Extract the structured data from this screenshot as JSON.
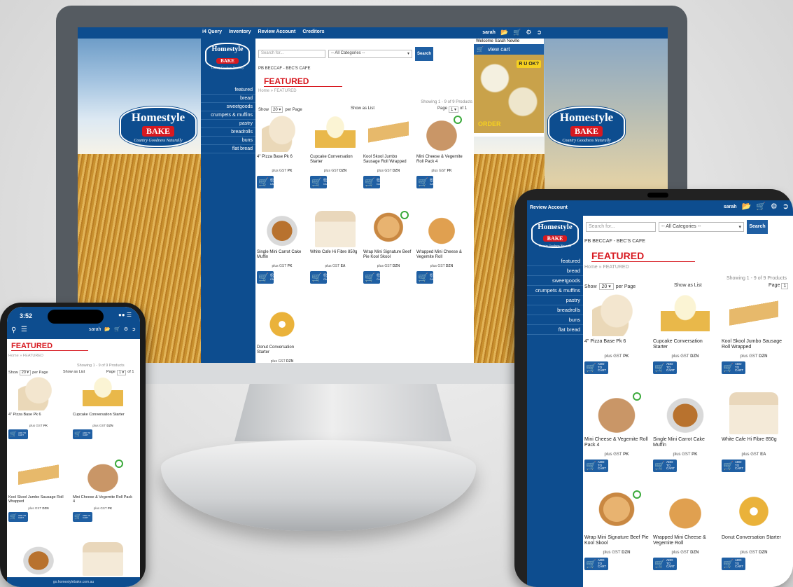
{
  "nav": [
    "i4 Query",
    "Inventory",
    "Review Account",
    "Creditors"
  ],
  "tablet_nav": [
    "Review Account"
  ],
  "user": "sarah",
  "welcome": "Welcome Sarah Neville",
  "view_cart": "view cart",
  "search_placeholder": "Search for...",
  "categories_default": "-- All Categories --",
  "search_button": "Search",
  "account_line": "PB BECCAF - BEC'S CAFE",
  "featured": "FEATURED",
  "breadcrumb": "Home » FEATURED",
  "showing": "Showing 1 - 9 of 9 Products",
  "show_label": "Show",
  "per_page_value": "20",
  "per_page_label": "per Page",
  "show_as_list": "Show as List",
  "page_label": "Page",
  "page_value": "1",
  "of_label": "of 1",
  "banner_ruok": "R U OK?",
  "banner_order": "ORDER",
  "logo": {
    "line1": "Homestyle",
    "line2": "BAKE",
    "line3": "Country Goodness Naturally"
  },
  "categories": [
    "featured",
    "bread",
    "sweetgoods",
    "crumpets & muffins",
    "pastry",
    "breadrolls",
    "buns",
    "flat bread"
  ],
  "add_to_cart": "ADD TO CART",
  "tax_prefix": "plus GST",
  "products": [
    {
      "name": "4\" Pizza Base Pk 6",
      "unit": "PK",
      "img": "img-pizza"
    },
    {
      "name": "Cupcake Conversation Starter",
      "unit": "DZN",
      "img": "img-cupcake"
    },
    {
      "name": "Kool Skool Jumbo Sausage Roll Wrapped",
      "unit": "DZN",
      "img": "img-roll"
    },
    {
      "name": "Mini Cheese & Vegemite Roll Pack 4",
      "unit": "PK",
      "img": "img-bag"
    },
    {
      "name": "Single Mini Carrot Cake Muffin",
      "unit": "PK",
      "img": "img-muffin"
    },
    {
      "name": "White Cafe Hi Fibre 850g",
      "unit": "EA",
      "img": "img-bread"
    },
    {
      "name": "Wrap Mini Signature Beef Pie Kool Skool",
      "unit": "DZN",
      "img": "img-pie"
    },
    {
      "name": "Wrapped Mini Cheese & Vegemite Roll",
      "unit": "DZN",
      "img": "img-wrapped"
    },
    {
      "name": "Donut Conversation Starter",
      "unit": "DZN",
      "img": "img-donut"
    }
  ],
  "phone": {
    "time": "3:52",
    "url": "go.homestylebake.com.au"
  },
  "colors": {
    "brand_blue": "#0d4d8f",
    "accent_red": "#d71920",
    "button_blue": "#1f5fa3"
  }
}
